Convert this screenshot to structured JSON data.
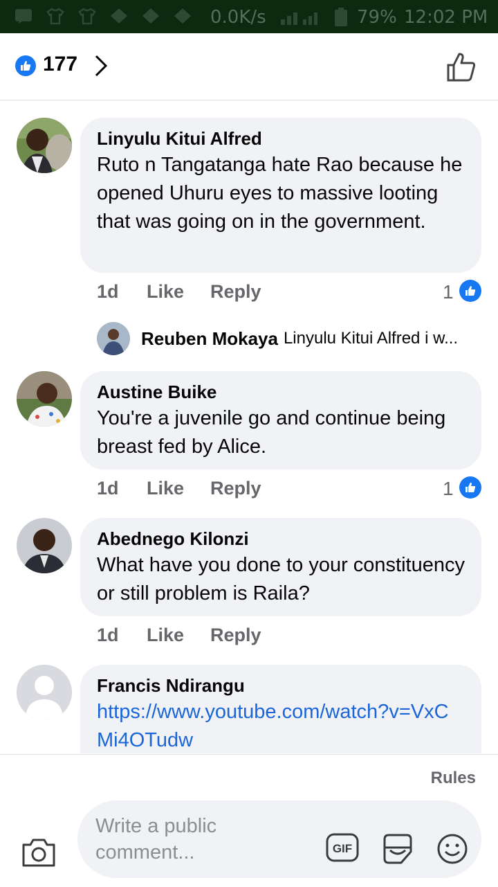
{
  "status_bar": {
    "network_speed": "0.0K/s",
    "battery": "79%",
    "time": "12:02 PM"
  },
  "header": {
    "reaction_count": "177"
  },
  "comments": [
    {
      "author": "Linyulu Kitui Alfred",
      "text": "Ruto n Tangatanga hate Rao because he opened Uhuru eyes to massive looting that was going on in the government.",
      "time": "1d",
      "like_label": "Like",
      "reply_label": "Reply",
      "reactions": "1",
      "reply": {
        "author": "Reuben Mokaya",
        "preview": "Linyulu Kitui Alfred i w..."
      }
    },
    {
      "author": "Austine Buike",
      "text": "You're a juvenile go and continue being breast fed by Alice.",
      "time": "1d",
      "like_label": "Like",
      "reply_label": "Reply",
      "reactions": "1"
    },
    {
      "author": "Abednego Kilonzi",
      "text": "What have you done to your constituency or still problem is Raila?",
      "time": "1d",
      "like_label": "Like",
      "reply_label": "Reply"
    },
    {
      "author": "Francis Ndirangu",
      "text": "https://www.youtube.com/watch?v=VxCMi4OTudw"
    }
  ],
  "footer": {
    "rules_label": "Rules",
    "input_placeholder": "Write a public comment..."
  },
  "colors": {
    "accent": "#1877f2",
    "bubble": "#f0f2f5",
    "meta_text": "#65676b",
    "link": "#1a66d8"
  }
}
